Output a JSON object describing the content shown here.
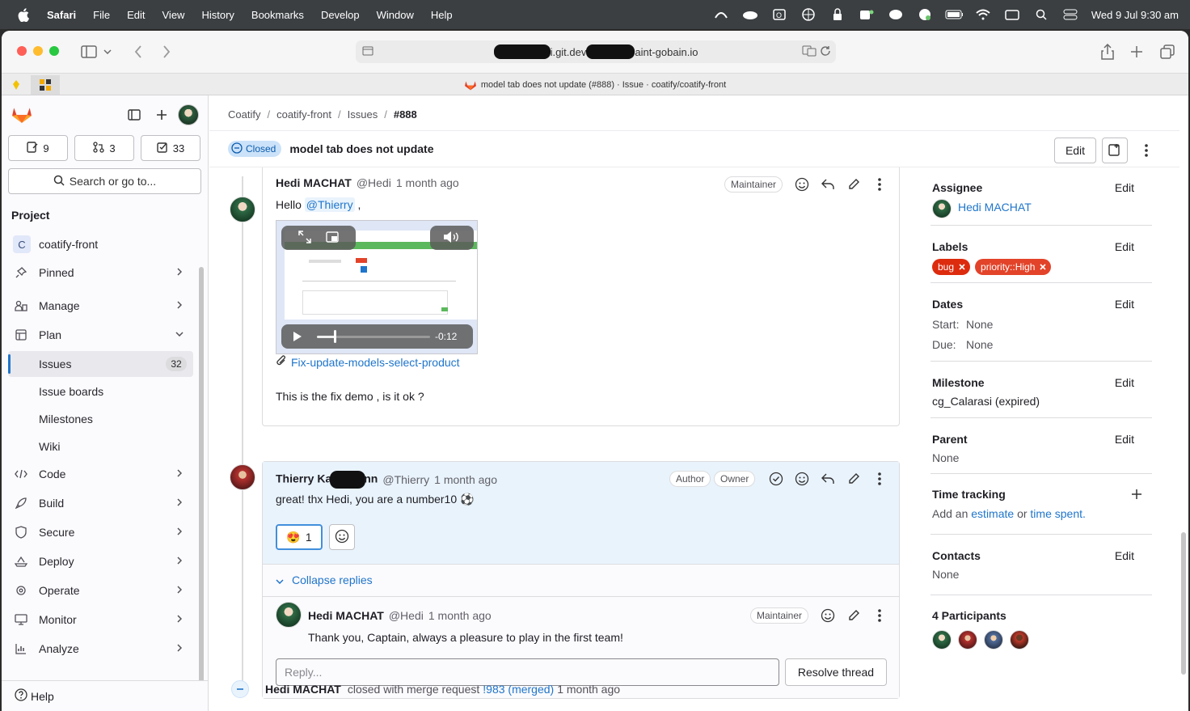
{
  "menubar": {
    "app": "Safari",
    "items": [
      "File",
      "Edit",
      "View",
      "History",
      "Bookmarks",
      "Develop",
      "Window",
      "Help"
    ],
    "clock": "Wed 9 Jul  9:30 am"
  },
  "browser": {
    "url": "i.git.dev  aint-gobain.io",
    "url_left": "i.git.dev",
    "url_right": "aint-gobain.io",
    "tab_title": "model tab does not update (#888) · Issue · coatify/coatify-front"
  },
  "sidebar": {
    "counters": [
      {
        "icon": "issues-icon",
        "value": "9"
      },
      {
        "icon": "merge-request-icon",
        "value": "3"
      },
      {
        "icon": "todo-icon",
        "value": "33"
      }
    ],
    "search_label": "Search or go to...",
    "section_title": "Project",
    "project_name": "coatify-front",
    "project_initial": "C",
    "items": {
      "pinned": "Pinned",
      "manage": "Manage",
      "plan": "Plan",
      "issues": "Issues",
      "issues_count": "32",
      "issue_boards": "Issue boards",
      "milestones": "Milestones",
      "wiki": "Wiki",
      "code": "Code",
      "build": "Build",
      "secure": "Secure",
      "deploy": "Deploy",
      "operate": "Operate",
      "monitor": "Monitor",
      "analyze": "Analyze"
    },
    "help": "Help"
  },
  "breadcrumb": {
    "b1": "Coatify",
    "b2": "coatify-front",
    "b3": "Issues",
    "b4": "#888",
    "sep": "/"
  },
  "issue": {
    "status": "Closed",
    "title": "model tab does not update",
    "edit_label": "Edit"
  },
  "notes": {
    "n1": {
      "author": "Hedi MACHAT",
      "handle": "@Hedi",
      "time": "1 month ago",
      "role": "Maintainer",
      "greeting": "Hello",
      "mention": "@Thierry",
      "comma": ",",
      "video_time": "-0:12",
      "attachment": "Fix-update-models-select-product",
      "body": "This is the fix demo , is it ok ?"
    },
    "n2": {
      "author": "Thierry Ka",
      "author_tail": "nn",
      "handle": "@Thierry",
      "time": "1 month ago",
      "role1": "Author",
      "role2": "Owner",
      "body": "great! thx Hedi, you are a number10 ⚽",
      "reaction_emoji": "😍",
      "reaction_count": "1",
      "collapse": "Collapse replies"
    },
    "n3": {
      "author": "Hedi MACHAT",
      "handle": "@Hedi",
      "time": "1 month ago",
      "role": "Maintainer",
      "body": "Thank you, Captain, always a pleasure to play in the first team!",
      "reply_placeholder": "Reply...",
      "resolve": "Resolve thread"
    },
    "system": {
      "author": "Hedi MACHAT",
      "text": "closed with merge request",
      "mr": "!983 (merged)",
      "time": "1 month ago"
    }
  },
  "right_sidebar": {
    "edit": "Edit",
    "assignee_title": "Assignee",
    "assignee": "Hedi MACHAT",
    "labels_title": "Labels",
    "label1": "bug",
    "label2": "priority::High",
    "dates_title": "Dates",
    "start_label": "Start:",
    "start_value": "None",
    "due_label": "Due:",
    "due_value": "None",
    "milestone_title": "Milestone",
    "milestone": "cg_Calarasi (expired)",
    "parent_title": "Parent",
    "parent": "None",
    "time_title": "Time tracking",
    "time_prefix": "Add an",
    "time_estimate": "estimate",
    "time_or": "or",
    "time_spent": "time spent",
    "time_dot": ".",
    "contacts_title": "Contacts",
    "contacts": "None",
    "participants_title": "4 Participants"
  },
  "colors": {
    "accent": "#1f75cb",
    "label_bug": "#dd2b0e",
    "label_priority": "#e24329",
    "closed_badge_bg": "#cbe2f9"
  }
}
